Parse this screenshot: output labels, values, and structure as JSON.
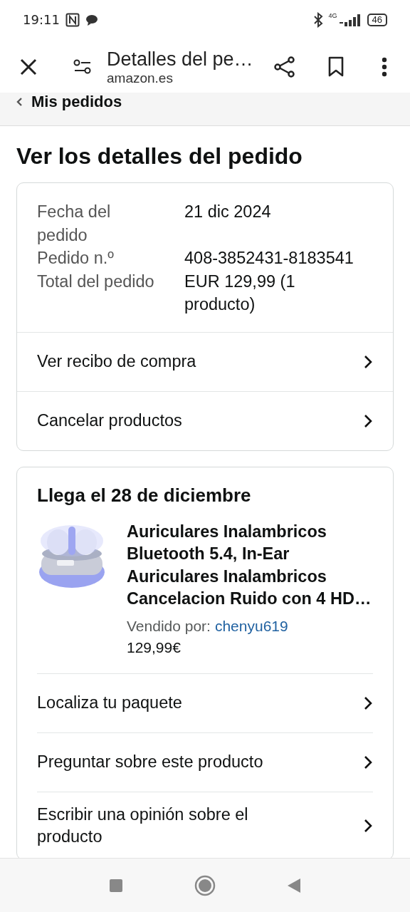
{
  "status_bar": {
    "time": "19:11",
    "network": "4G",
    "battery": "46"
  },
  "toolbar": {
    "title": "Detalles del pe…",
    "url": "amazon.es"
  },
  "breadcrumb": {
    "label": "Mis pedidos"
  },
  "heading": "Ver los detalles del pedido",
  "summary": {
    "fields": [
      {
        "label": "Fecha del pedido",
        "value": "21 dic 2024"
      },
      {
        "label": "Pedido n.º",
        "value": "408-3852431-8183541"
      },
      {
        "label": "Total del pedido",
        "value": "EUR 129,99 (1 producto)"
      }
    ],
    "links": [
      "Ver recibo de compra",
      "Cancelar productos"
    ]
  },
  "shipment": {
    "title": "Llega el 28 de diciembre",
    "product": {
      "name": "Auriculares Inalambricos Bluetooth 5.4, In-Ear Auriculares Inalambricos Cancelacion Ruido con 4 HD…",
      "seller_label": "Vendido por:",
      "seller": "chenyu619",
      "price": "129,99€"
    },
    "actions": [
      "Localiza tu paquete",
      "Preguntar sobre este producto",
      "Escribir una opinión sobre el producto"
    ]
  }
}
